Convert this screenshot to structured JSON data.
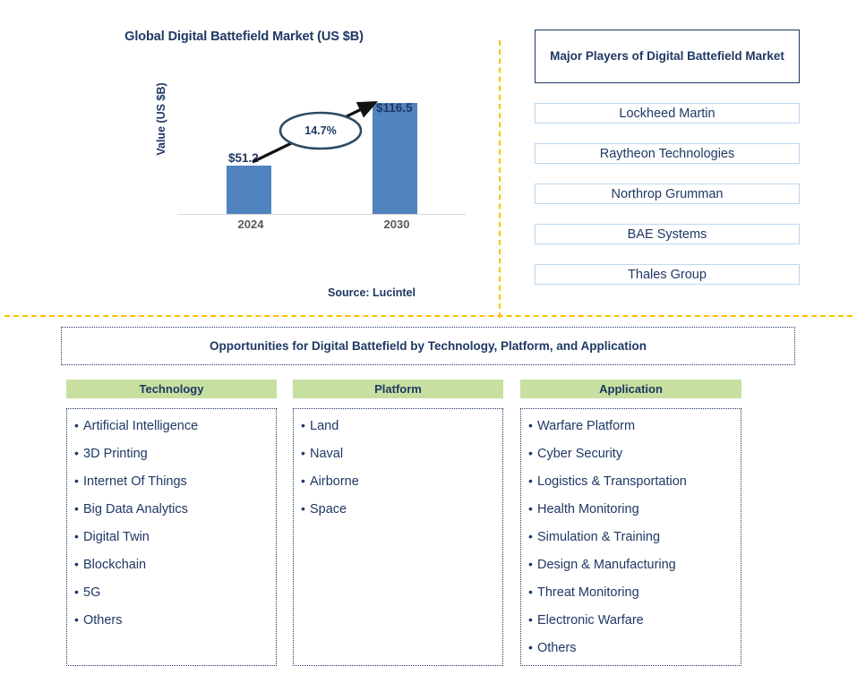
{
  "chart_panel": {
    "title": "Global Digital Battefield Market (US $B)",
    "y_axis_title": "Value (US $B)",
    "cagr_label": "14.7%",
    "source": "Source: Lucintel"
  },
  "chart_data": {
    "type": "bar",
    "title": "Global Digital Battefield Market (US $B)",
    "xlabel": "",
    "ylabel": "Value (US $B)",
    "categories": [
      "2024",
      "2030"
    ],
    "values": [
      51.2,
      116.5
    ],
    "data_labels": [
      "$51.2",
      "$116.5"
    ],
    "ylim": [
      0,
      130
    ],
    "grid": false,
    "legend": "none",
    "annotations": [
      {
        "text": "14.7%",
        "kind": "cagr-callout",
        "between": [
          "2024",
          "2030"
        ]
      }
    ],
    "series": [
      {
        "name": "Global Digital Battefield Market",
        "values": [
          51.2,
          116.5
        ],
        "color": "#5183bf"
      }
    ],
    "source": "Source: Lucintel"
  },
  "players": {
    "header": "Major Players of Digital Battefield Market",
    "items": [
      "Lockheed Martin",
      "Raytheon Technologies",
      "Northrop Grumman",
      "BAE Systems",
      "Thales Group"
    ]
  },
  "opportunities": {
    "banner": "Opportunities for Digital Battefield by Technology, Platform, and Application",
    "columns": [
      {
        "header": "Technology",
        "items": [
          "Artificial Intelligence",
          "3D Printing",
          "Internet Of Things",
          "Big Data Analytics",
          "Digital Twin",
          "Blockchain",
          "5G",
          "Others"
        ]
      },
      {
        "header": "Platform",
        "items": [
          "Land",
          "Naval",
          "Airborne",
          "Space"
        ]
      },
      {
        "header": "Application",
        "items": [
          "Warfare Platform",
          "Cyber Security",
          "Logistics & Transportation",
          "Health Monitoring",
          "Simulation & Training",
          "Design & Manufacturing",
          "Threat Monitoring",
          "Electronic Warfare",
          "Others"
        ]
      }
    ]
  },
  "colors": {
    "navy_text": "#1f3864",
    "bar_blue": "#5183bf",
    "header_green": "#c7e0a0",
    "divider_amber": "#ffc000",
    "player_border": "#bdd7ee",
    "tick_grey": "#595959"
  },
  "bullet_char": "•"
}
